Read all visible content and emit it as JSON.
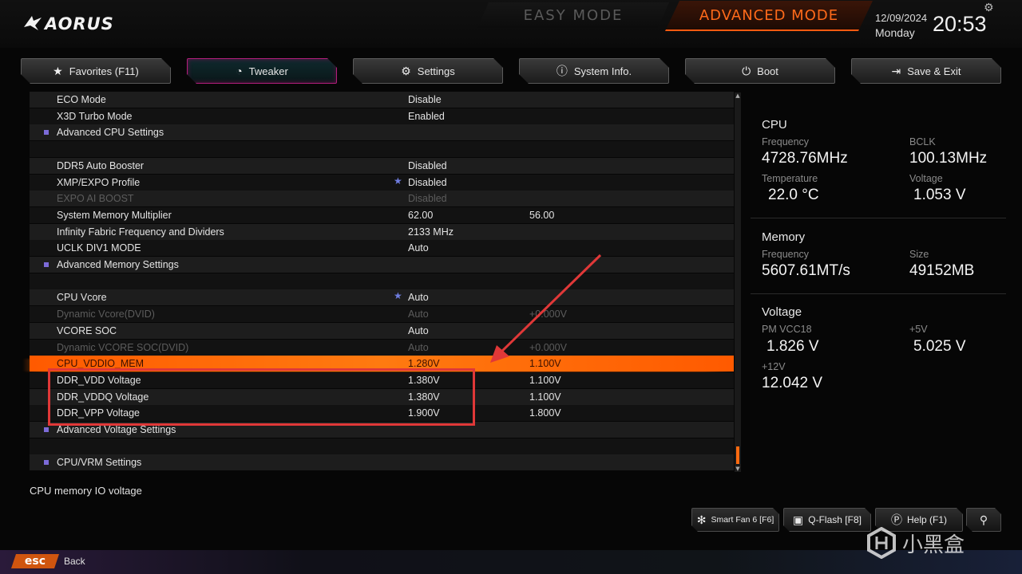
{
  "header": {
    "brand": "AORUS",
    "easy_mode": "EASY MODE",
    "advanced_mode": "ADVANCED MODE",
    "date": "12/09/2024",
    "day": "Monday",
    "time": "20:53"
  },
  "tabs": [
    {
      "label": "Favorites (F11)",
      "icon": "star-icon",
      "active": false
    },
    {
      "label": "Tweaker",
      "icon": "speedometer-icon",
      "active": true
    },
    {
      "label": "Settings",
      "icon": "gear-icon",
      "active": false
    },
    {
      "label": "System Info.",
      "icon": "info-icon",
      "active": false
    },
    {
      "label": "Boot",
      "icon": "power-icon",
      "active": false
    },
    {
      "label": "Save & Exit",
      "icon": "exit-icon",
      "active": false
    }
  ],
  "settings": [
    {
      "label": "ECO Mode",
      "value": "Disable",
      "value2": ""
    },
    {
      "label": "X3D Turbo Mode",
      "value": "Enabled",
      "value2": ""
    },
    {
      "label": "Advanced CPU Settings",
      "value": "",
      "value2": ""
    },
    {
      "label": "",
      "value": "",
      "value2": ""
    },
    {
      "label": "DDR5 Auto Booster",
      "value": "Disabled",
      "value2": ""
    },
    {
      "label": "XMP/EXPO Profile",
      "value": "Disabled",
      "value2": ""
    },
    {
      "label": "EXPO AI BOOST",
      "value": "Disabled",
      "value2": ""
    },
    {
      "label": "System Memory Multiplier",
      "value": "62.00",
      "value2": "56.00"
    },
    {
      "label": "Infinity Fabric Frequency and Dividers",
      "value": "2133 MHz",
      "value2": ""
    },
    {
      "label": "UCLK DIV1 MODE",
      "value": "Auto",
      "value2": ""
    },
    {
      "label": "Advanced Memory Settings",
      "value": "",
      "value2": ""
    },
    {
      "label": "",
      "value": "",
      "value2": ""
    },
    {
      "label": "CPU Vcore",
      "value": "Auto",
      "value2": ""
    },
    {
      "label": "Dynamic Vcore(DVID)",
      "value": "Auto",
      "value2": "+0.000V"
    },
    {
      "label": "VCORE SOC",
      "value": "Auto",
      "value2": ""
    },
    {
      "label": "Dynamic VCORE SOC(DVID)",
      "value": "Auto",
      "value2": "+0.000V"
    },
    {
      "label": "CPU_VDDIO_MEM",
      "value": "1.280V",
      "value2": "1.100V"
    },
    {
      "label": "DDR_VDD Voltage",
      "value": "1.380V",
      "value2": "1.100V"
    },
    {
      "label": "DDR_VDDQ Voltage",
      "value": "1.380V",
      "value2": "1.100V"
    },
    {
      "label": "DDR_VPP Voltage",
      "value": "1.900V",
      "value2": "1.800V"
    },
    {
      "label": "Advanced Voltage Settings",
      "value": "",
      "value2": ""
    },
    {
      "label": "",
      "value": "",
      "value2": ""
    },
    {
      "label": "CPU/VRM Settings",
      "value": "",
      "value2": ""
    }
  ],
  "description": "CPU memory IO voltage",
  "info": {
    "cpu": {
      "title": "CPU",
      "frequency_label": "Frequency",
      "frequency": "4728.76MHz",
      "bclk_label": "BCLK",
      "bclk": "100.13MHz",
      "temperature_label": "Temperature",
      "temperature": "22.0 °C",
      "voltage_label": "Voltage",
      "voltage": "1.053 V"
    },
    "memory": {
      "title": "Memory",
      "frequency_label": "Frequency",
      "frequency": "5607.61MT/s",
      "size_label": "Size",
      "size": "49152MB"
    },
    "voltage": {
      "title": "Voltage",
      "pmvcc18_label": "PM VCC18",
      "pmvcc18": "1.826 V",
      "plus5_label": "+5V",
      "plus5": "5.025 V",
      "plus12_label": "+12V",
      "plus12": "12.042 V"
    }
  },
  "bottom_buttons": {
    "smartfan": "Smart Fan 6 [F6]",
    "qflash": "Q-Flash [F8]",
    "help": "Help (F1)"
  },
  "footer": {
    "esc": "esc",
    "back": "Back"
  },
  "watermark": "小黑盒",
  "colors": {
    "accent": "#ff6a1a",
    "highlight": "#ff6a10",
    "annotation": "#e03838",
    "bullet": "#7c6bd8"
  }
}
